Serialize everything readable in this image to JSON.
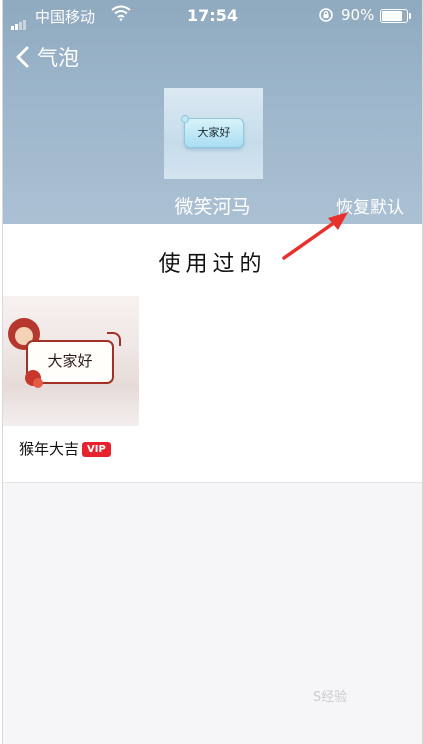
{
  "status_bar": {
    "carrier": "中国移动",
    "time": "17:54",
    "battery_percent": "90%",
    "battery_level": 0.9
  },
  "nav": {
    "back_icon": "chevron-left-icon",
    "title": "气泡"
  },
  "current_bubble": {
    "preview_text": "大家好",
    "name": "微笑河马",
    "restore_label": "恢复默认"
  },
  "used_section": {
    "title": "使用过的",
    "items": [
      {
        "preview_text": "大家好",
        "name": "猴年大吉",
        "badge": "VIP"
      }
    ]
  },
  "watermark": "S经验",
  "colors": {
    "header_bg": "#9db6cb",
    "vip_badge": "#e8222c",
    "annotation_arrow": "#e8302c"
  }
}
